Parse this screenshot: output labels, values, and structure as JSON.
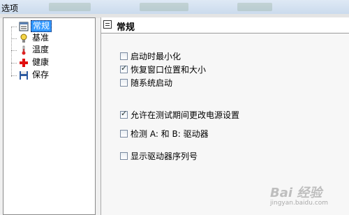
{
  "window": {
    "title": "选项"
  },
  "tree": {
    "items": [
      {
        "label": "常规",
        "icon": "window-icon",
        "selected": true
      },
      {
        "label": "基准",
        "icon": "lightbulb-icon",
        "selected": false
      },
      {
        "label": "温度",
        "icon": "thermometer-icon",
        "selected": false
      },
      {
        "label": "健康",
        "icon": "red-cross-icon",
        "selected": false
      },
      {
        "label": "保存",
        "icon": "floppy-disk-icon",
        "selected": false
      }
    ]
  },
  "panel": {
    "title": "常规",
    "options": [
      {
        "label": "启动时最小化",
        "checked": false
      },
      {
        "label": "恢复窗口位置和大小",
        "checked": true
      },
      {
        "label": "随系统启动",
        "checked": false
      },
      {
        "label": "允许在测试期间更改电源设置",
        "checked": true
      },
      {
        "label": "检测 A: 和 B: 驱动器",
        "checked": false
      },
      {
        "label": "显示驱动器序列号",
        "checked": false
      }
    ]
  },
  "watermark": {
    "text": "Bai 经验",
    "sub": "jingyan.baidu.com"
  }
}
